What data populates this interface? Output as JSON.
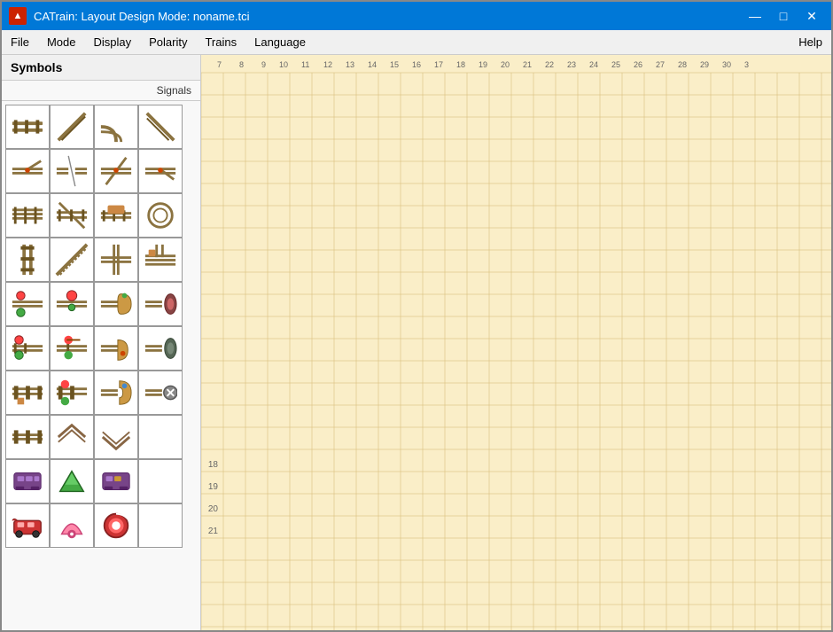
{
  "window": {
    "title": "CATrain: Layout Design Mode: noname.tci",
    "icon_text": "▲"
  },
  "title_controls": {
    "minimize": "—",
    "maximize": "□",
    "close": "✕"
  },
  "menu": {
    "items": [
      "File",
      "Mode",
      "Display",
      "Polarity",
      "Trains",
      "Language"
    ],
    "help": "Help"
  },
  "symbols_panel": {
    "header": "Symbols",
    "signals_tab": "Signals"
  },
  "grid": {
    "col_numbers": [
      "",
      "7",
      "8",
      "9",
      "10",
      "11",
      "12",
      "13",
      "14",
      "15",
      "16",
      "17",
      "18",
      "19",
      "20",
      "21",
      "22",
      "23",
      "24",
      "25",
      "26",
      "27",
      "28",
      "29",
      "30",
      "3"
    ],
    "row_numbers": [
      "",
      "",
      "",
      "",
      "",
      "",
      "",
      "",
      "",
      "",
      "",
      "",
      "",
      "",
      "",
      "",
      "",
      "18",
      "19",
      "20",
      "21"
    ]
  },
  "symbols": [
    {
      "id": 1,
      "type": "track_straight_h"
    },
    {
      "id": 2,
      "type": "track_diagonal"
    },
    {
      "id": 3,
      "type": "track_curve"
    },
    {
      "id": 4,
      "type": "track_diagonal2"
    },
    {
      "id": 5,
      "type": "switch_left"
    },
    {
      "id": 6,
      "type": "connector"
    },
    {
      "id": 7,
      "type": "switch_cross"
    },
    {
      "id": 8,
      "type": "switch_right"
    },
    {
      "id": 9,
      "type": "track_h2"
    },
    {
      "id": 10,
      "type": "track_h3"
    },
    {
      "id": 11,
      "type": "track_h4"
    },
    {
      "id": 12,
      "type": "track_circle"
    },
    {
      "id": 13,
      "type": "track_straight_v"
    },
    {
      "id": 14,
      "type": "track_diag3"
    },
    {
      "id": 15,
      "type": "track_cross"
    },
    {
      "id": 16,
      "type": "track_multi"
    },
    {
      "id": 17,
      "type": "sensor_green"
    },
    {
      "id": 18,
      "type": "sensor_red"
    },
    {
      "id": 19,
      "type": "sensor_bell"
    },
    {
      "id": 20,
      "type": "sensor_oval"
    },
    {
      "id": 21,
      "type": "signal_lamp"
    },
    {
      "id": 22,
      "type": "signal_stop"
    },
    {
      "id": 23,
      "type": "signal_bell2"
    },
    {
      "id": 24,
      "type": "signal_oval2"
    },
    {
      "id": 25,
      "type": "block_a"
    },
    {
      "id": 26,
      "type": "block_b"
    },
    {
      "id": 27,
      "type": "block_c"
    },
    {
      "id": 28,
      "type": "block_circle"
    },
    {
      "id": 29,
      "type": "decor_a"
    },
    {
      "id": 30,
      "type": "decor_b"
    },
    {
      "id": 31,
      "type": "decor_c"
    },
    {
      "id": 32,
      "type": "empty"
    },
    {
      "id": 33,
      "type": "item_purple"
    },
    {
      "id": 34,
      "type": "item_green"
    },
    {
      "id": 35,
      "type": "item_purple2"
    },
    {
      "id": 36,
      "type": "empty2"
    },
    {
      "id": 37,
      "type": "train_red"
    },
    {
      "id": 38,
      "type": "train_pink"
    },
    {
      "id": 39,
      "type": "train_whistle"
    },
    {
      "id": 40,
      "type": "empty3"
    }
  ]
}
